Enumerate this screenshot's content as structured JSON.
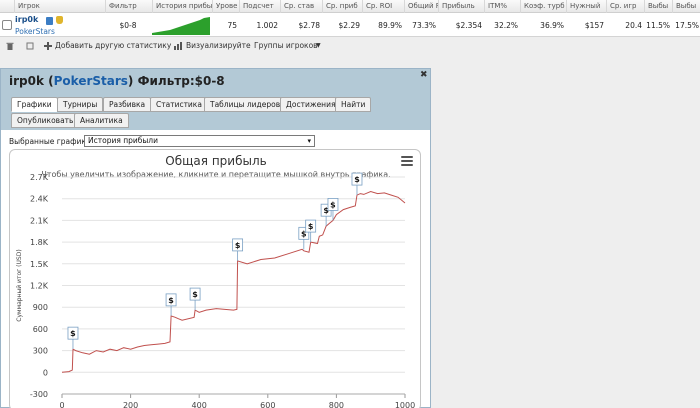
{
  "stats_table": {
    "headers": [
      "Игрок",
      "Фильтр",
      "История прибы",
      "Урове",
      "Подсчет",
      "Ср. став",
      "Ср. приб",
      "Ср. ROI",
      "Общий R",
      "Прибыль",
      "ITM%",
      "Коэф. турб",
      "Нужный",
      "Ср. игр",
      "Выбы",
      "Выбы"
    ],
    "player": "irp0k",
    "site": "PokerStars",
    "row": [
      "$0-8",
      "75",
      "1.002",
      "$2.78",
      "$2.29",
      "89.9%",
      "73.3%",
      "$2.354",
      "32.2%",
      "36.9%",
      "$157",
      "20.4",
      "11.5%",
      "17.5%"
    ]
  },
  "toolbar": {
    "add_stat": "Добавить другую статистику",
    "visualize": "Визуализируйте",
    "player_groups": "Группы игроков"
  },
  "dialog": {
    "player": "irp0k",
    "site": "PokerStars",
    "filter": "Фильтр:$0-8",
    "tabs_row1": [
      "Графики",
      "Турниры",
      "Разбивка",
      "Статистика",
      "Таблицы лидеров",
      "Достижения",
      "Найти"
    ],
    "tabs_row2": [
      "Опубликовать",
      "Аналитика"
    ],
    "selected_graphs_label": "Выбранные графики:",
    "selected_graph": "История прибыли"
  },
  "icons": [
    "checkbox-icon",
    "flag-icon",
    "trophy-icon",
    "trash-icon",
    "add-icon",
    "chart-icon",
    "dropdown-arrow-icon",
    "close-icon",
    "menu-icon",
    "dollar-marker-icon"
  ],
  "colors": {
    "line": "#c0504d",
    "title_bar": "#b3c9d6",
    "link": "#1a5ea8",
    "sparkline": "#2ca02c"
  },
  "chart_data": {
    "type": "line",
    "title": "Общая прибыль",
    "subtitle": "Чтобы увеличить изображение, кликните и перетащите мышкой внутрь графика.",
    "ylabel": "Суммарный итог (USD)",
    "xlabel": "",
    "xlim": [
      0,
      1000
    ],
    "ylim": [
      -300,
      2700
    ],
    "x_ticks": [
      "0",
      "200",
      "400",
      "600",
      "800",
      "1000"
    ],
    "y_ticks": [
      "-300",
      "0",
      "300",
      "600",
      "900",
      "1.2K",
      "1.5K",
      "1.8K",
      "2.1K",
      "2.4K",
      "2.7K"
    ],
    "grid": true,
    "x": [
      0,
      20,
      30,
      32,
      40,
      60,
      80,
      100,
      120,
      140,
      160,
      180,
      200,
      220,
      240,
      260,
      280,
      300,
      315,
      318,
      330,
      340,
      350,
      385,
      388,
      400,
      420,
      450,
      500,
      510,
      512,
      540,
      580,
      620,
      660,
      700,
      705,
      720,
      725,
      745,
      750,
      760,
      770,
      780,
      790,
      800,
      820,
      840,
      855,
      860,
      870,
      880,
      900,
      920,
      940,
      960,
      980,
      1000
    ],
    "y": [
      0,
      10,
      30,
      320,
      300,
      270,
      250,
      300,
      280,
      320,
      300,
      340,
      320,
      350,
      370,
      380,
      390,
      400,
      420,
      780,
      760,
      740,
      720,
      760,
      860,
      830,
      860,
      880,
      860,
      870,
      1540,
      1500,
      1560,
      1580,
      1640,
      1700,
      1680,
      1660,
      1800,
      1780,
      1880,
      1900,
      2020,
      2060,
      2100,
      2180,
      2250,
      2280,
      2300,
      2450,
      2470,
      2460,
      2500,
      2470,
      2480,
      2450,
      2420,
      2340
    ],
    "markers": [
      {
        "x": 32,
        "y": 320,
        "label": "$"
      },
      {
        "x": 318,
        "y": 780,
        "label": "$"
      },
      {
        "x": 388,
        "y": 860,
        "label": "$"
      },
      {
        "x": 512,
        "y": 1540,
        "label": "$"
      },
      {
        "x": 705,
        "y": 1700,
        "label": "$"
      },
      {
        "x": 725,
        "y": 1800,
        "label": "$"
      },
      {
        "x": 770,
        "y": 2020,
        "label": "$"
      },
      {
        "x": 790,
        "y": 2100,
        "label": "$"
      },
      {
        "x": 860,
        "y": 2450,
        "label": "$"
      }
    ]
  }
}
